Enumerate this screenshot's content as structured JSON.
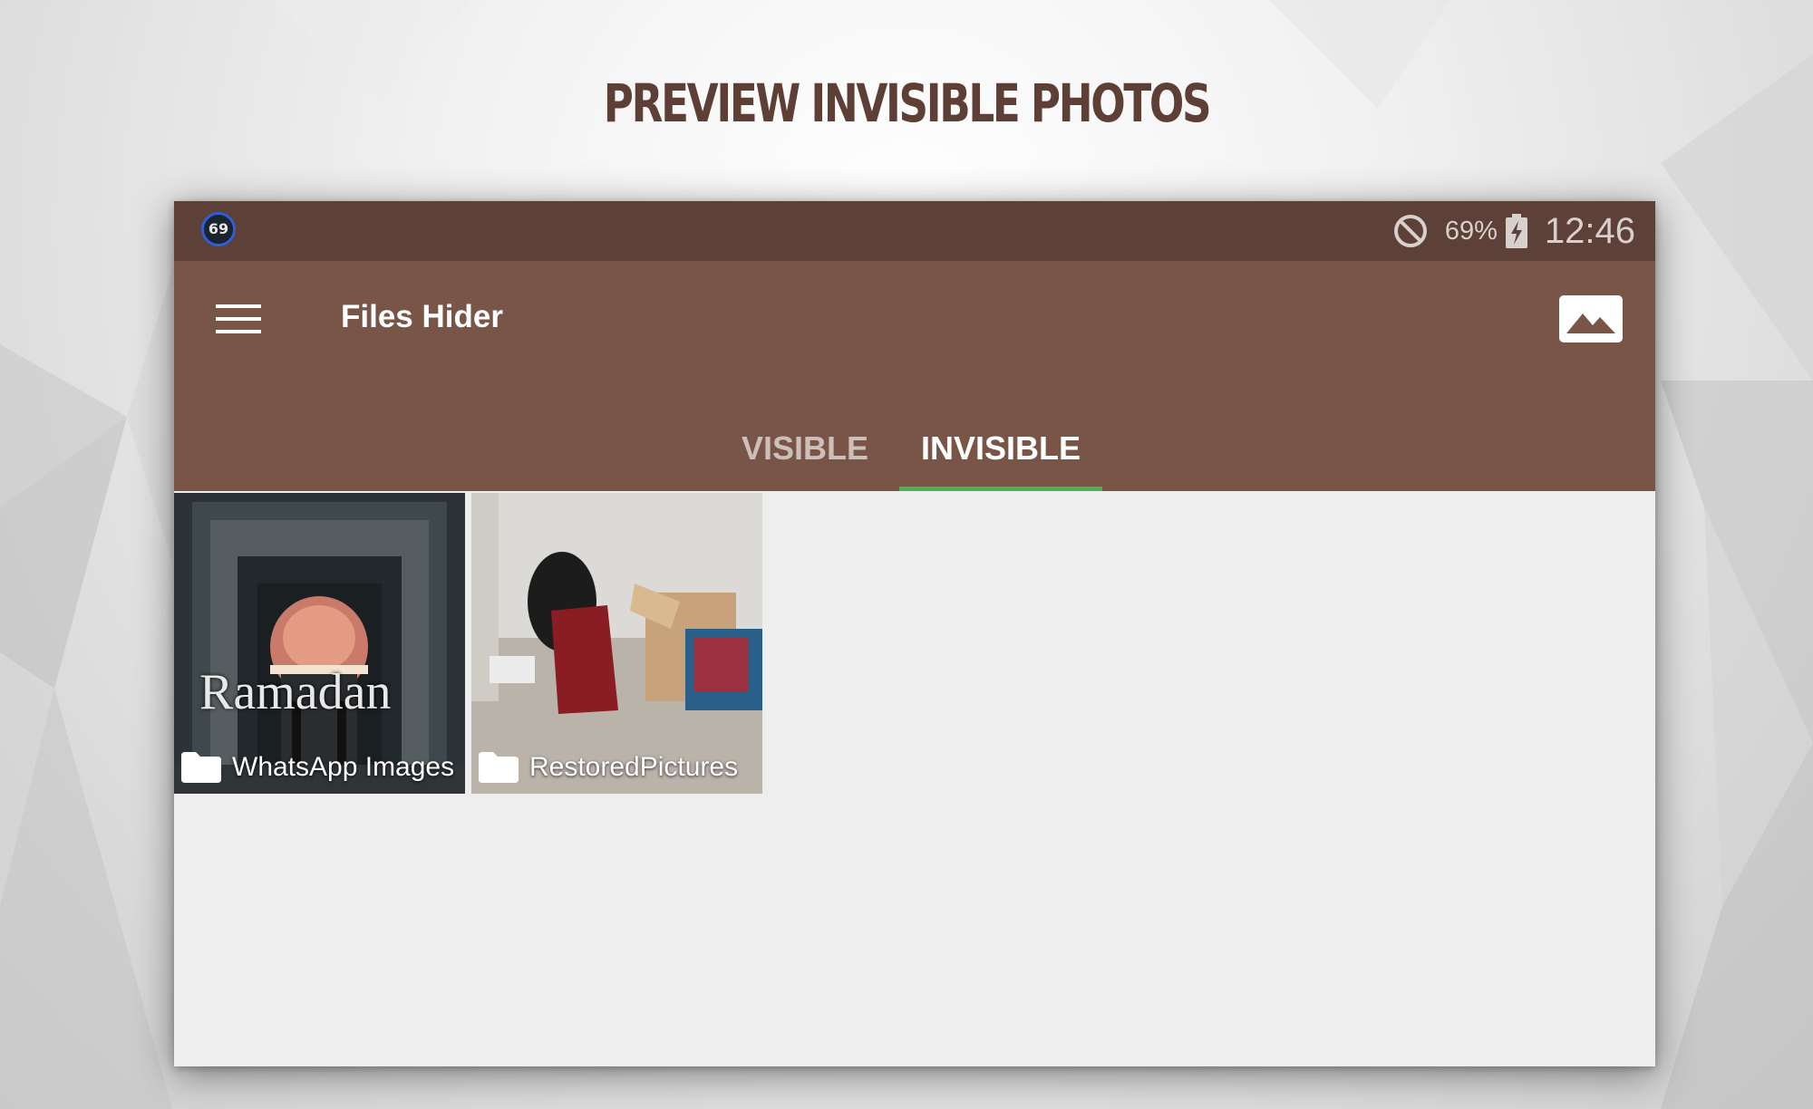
{
  "headline": "PREVIEW INVISIBLE PHOTOS",
  "status_bar": {
    "notification_badge": "69",
    "battery_percent": "69%",
    "time": "12:46",
    "icons": [
      "do-not-disturb-icon",
      "battery-charging-icon"
    ]
  },
  "app_bar": {
    "title": "Files Hider",
    "icons": [
      "menu-icon",
      "gallery-icon"
    ]
  },
  "tabs": [
    {
      "label": "VISIBLE",
      "selected": false
    },
    {
      "label": "INVISIBLE",
      "selected": true
    }
  ],
  "folders": [
    {
      "name": "WhatsApp Images",
      "thumbnail_text": "Ramadan",
      "icon": "folder-icon"
    },
    {
      "name": "RestoredPictures",
      "icon": "folder-icon"
    }
  ],
  "colors": {
    "status_bar": "#5d4037",
    "app_bar": "#795548",
    "tab_indicator": "#4caf50",
    "headline": "#5d3f35",
    "content_bg": "#eeeeee"
  }
}
